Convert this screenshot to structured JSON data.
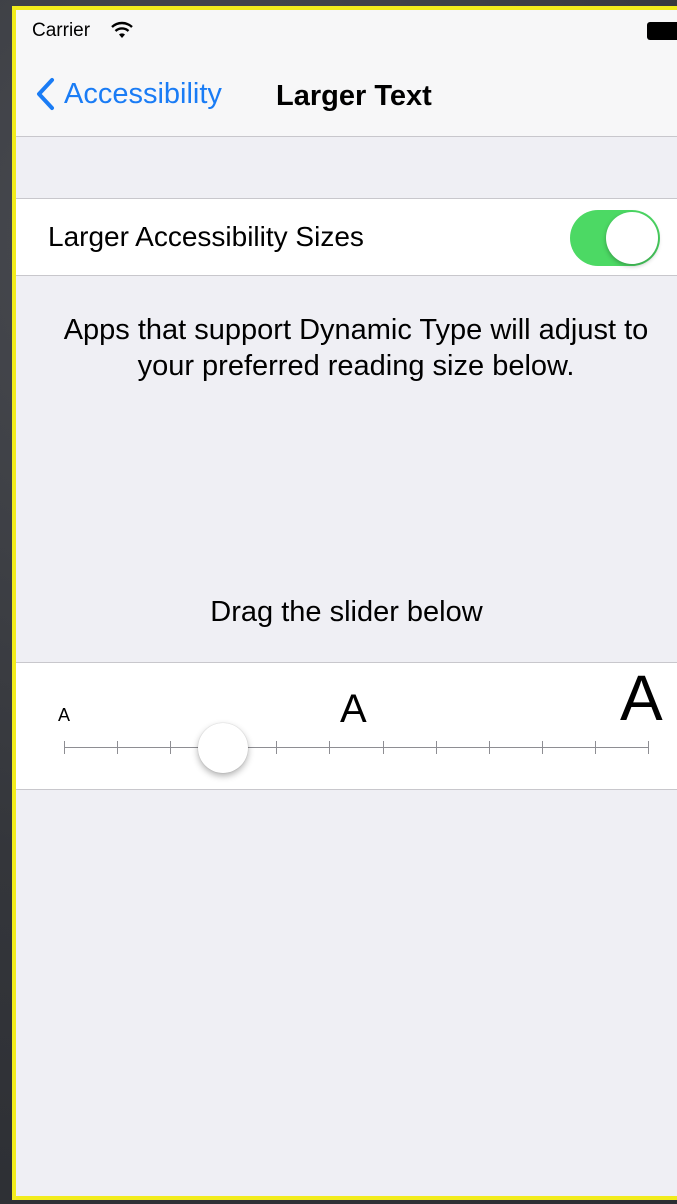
{
  "status_bar": {
    "carrier": "Carrier",
    "wifi_icon": "wifi-icon",
    "battery_icon": "battery-icon"
  },
  "nav": {
    "back_label": "Accessibility",
    "title": "Larger Text"
  },
  "toggle": {
    "label": "Larger Accessibility Sizes",
    "on": true,
    "on_color": "#4cd964"
  },
  "description": "Apps that support Dynamic Type will adjust to your preferred reading size below.",
  "drag_hint": "Drag the slider below",
  "slider": {
    "min_label": "A",
    "mid_label": "A",
    "max_label": "A",
    "steps": 12,
    "selected_step": 3
  },
  "colors": {
    "accent": "#1a7cf5",
    "background": "#efeff4",
    "highlight_border": "#f2ec1c"
  }
}
